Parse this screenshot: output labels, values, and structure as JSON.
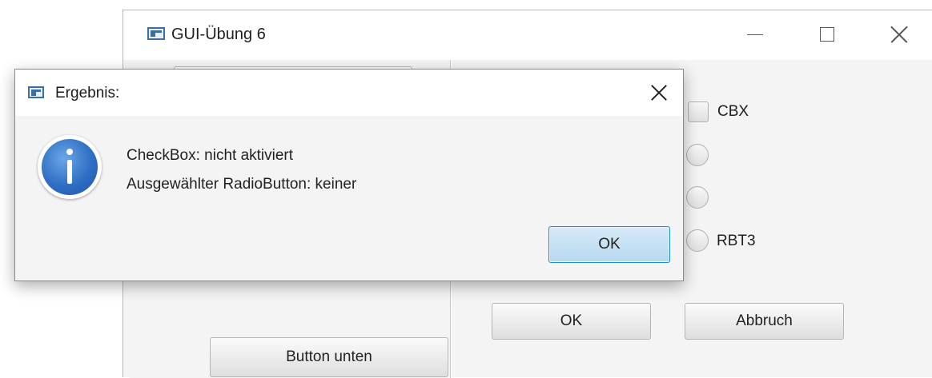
{
  "main_window": {
    "title": "GUI-Übung 6",
    "left_pane": {
      "button_label": "Button unten"
    },
    "right_pane": {
      "checkbox_label": "CBX",
      "radio_label_3": "RBT3",
      "ok_label": "OK",
      "cancel_label": "Abbruch"
    }
  },
  "dialog": {
    "title": "Ergebnis:",
    "message_line_1": "CheckBox: nicht aktiviert",
    "message_line_2": "Ausgewählter RadioButton: keiner",
    "ok_label": "OK",
    "icon": "info-icon"
  },
  "colors": {
    "default_button_border": "#1d8ad1",
    "info_icon": "#2f6fc4",
    "window_bg": "#f4f4f4"
  }
}
